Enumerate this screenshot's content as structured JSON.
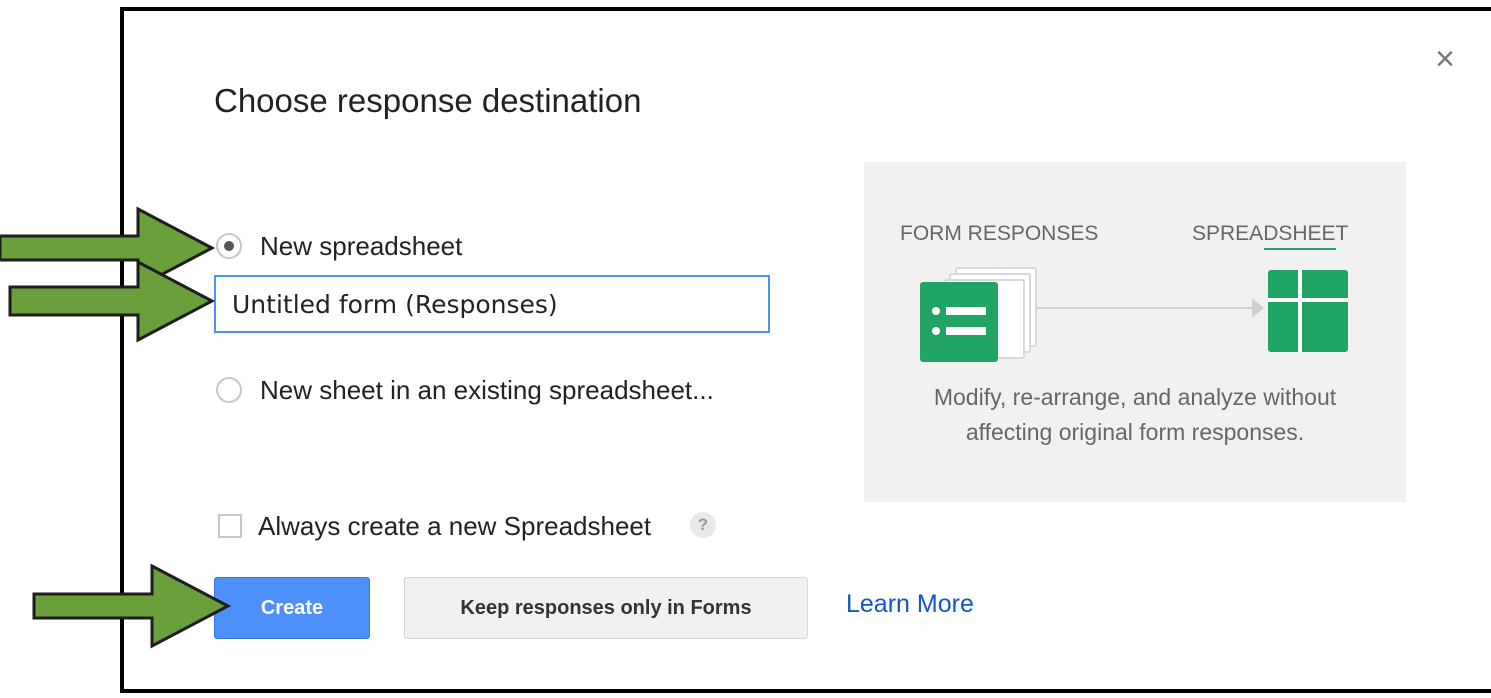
{
  "dialog": {
    "title": "Choose response destination",
    "close_icon": "close-icon"
  },
  "options": {
    "new_spreadsheet_label": "New spreadsheet",
    "new_spreadsheet_selected": true,
    "spreadsheet_name_value": "Untitled form (Responses)",
    "existing_spreadsheet_label": "New sheet in an existing spreadsheet...",
    "always_create_label": "Always create a new Spreadsheet",
    "always_create_checked": false,
    "help_icon_text": "?"
  },
  "promo": {
    "from_label": "FORM RESPONSES",
    "to_label": "SPREADSHEET",
    "description_line1": "Modify, re-arrange, and analyze without",
    "description_line2": "affecting original form responses.",
    "forms_icon": "forms-icon",
    "sheets_icon": "sheets-icon",
    "accent_green": "#1fa463"
  },
  "buttons": {
    "create_label": "Create",
    "keep_label": "Keep responses only in Forms",
    "learn_more_label": "Learn More"
  },
  "annotations": {
    "arrow_color": "#6aa03c",
    "arrow_icon": "arrow-right-icon"
  }
}
